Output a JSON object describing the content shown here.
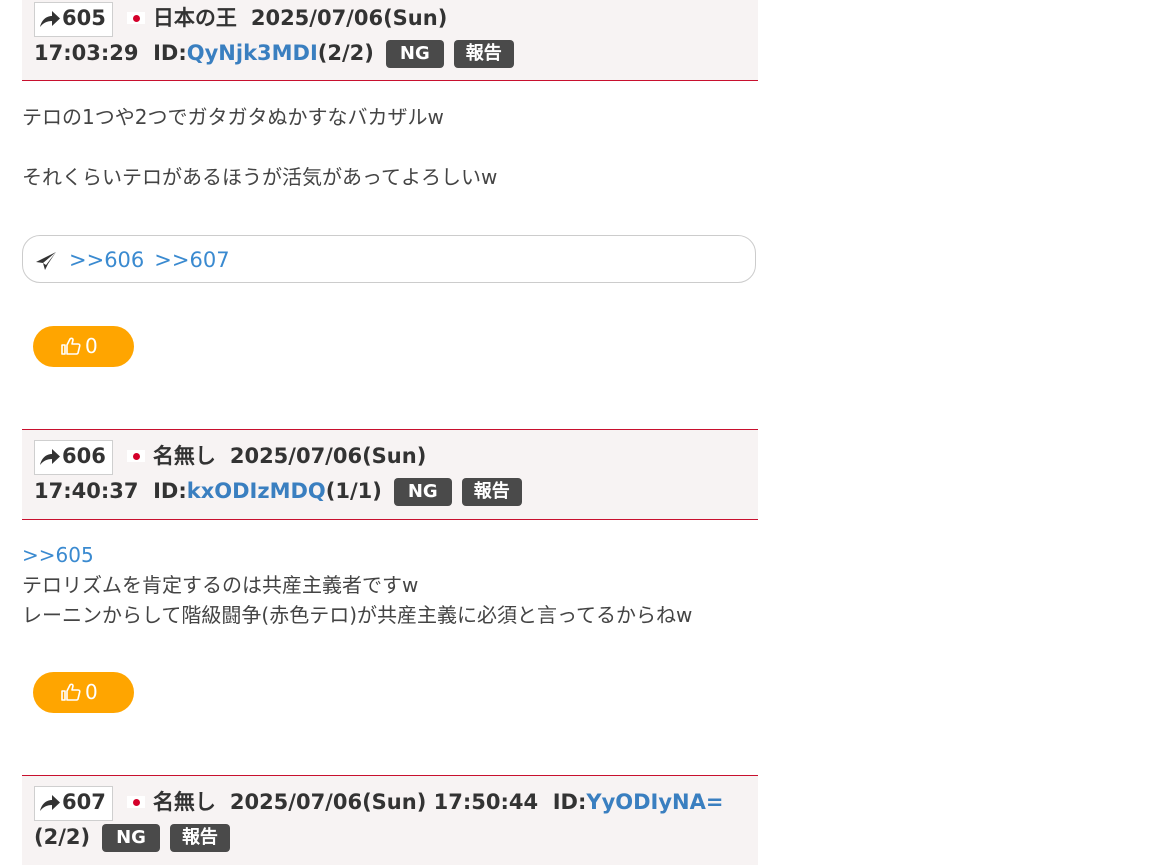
{
  "posts": [
    {
      "number": "605",
      "name": "日本の王",
      "datetime_line1": "2025/07/06(Sun)",
      "datetime_line2": "17:03:29",
      "id_label": "ID:",
      "id_value": "QyNjk3MDI",
      "id_count": "(2/2)",
      "ng_label": "NG",
      "report_label": "報告",
      "body_lines": [
        "テロの1つや2つでガタガタぬかすなバカザルw",
        "",
        "それくらいテロがあるほうが活気があってよろしいw"
      ],
      "replies": [
        ">>606",
        ">>607"
      ],
      "likes": "0"
    },
    {
      "number": "606",
      "name": "名無し",
      "datetime_line1": "2025/07/06(Sun)",
      "datetime_line2": "17:40:37",
      "id_label": "ID:",
      "id_value": "kxODIzMDQ",
      "id_count": "(1/1)",
      "ng_label": "NG",
      "report_label": "報告",
      "anchor": ">>605",
      "body_lines": [
        "テロリズムを肯定するのは共産主義者ですw",
        "レーニンからして階級闘争(赤色テロ)が共産主義に必須と言ってるからねw"
      ],
      "likes": "0"
    },
    {
      "number": "607",
      "name": "名無し",
      "datetime": "2025/07/06(Sun) 17:50:44",
      "id_label": "ID:",
      "id_value": "YyODIyNA=",
      "id_count": "(2/2)",
      "ng_label": "NG",
      "report_label": "報告"
    }
  ],
  "colors": {
    "header_bg": "#f7f3f3",
    "divider": "#c8102e",
    "link": "#3a8ad0",
    "like_button": "#ffa500",
    "tag_bg": "#4a4a4a"
  },
  "icons": {
    "post_number": "share-arrow-icon",
    "country": "japan-flag-icon",
    "reply": "paper-plane-icon",
    "like": "thumbs-up-icon"
  }
}
